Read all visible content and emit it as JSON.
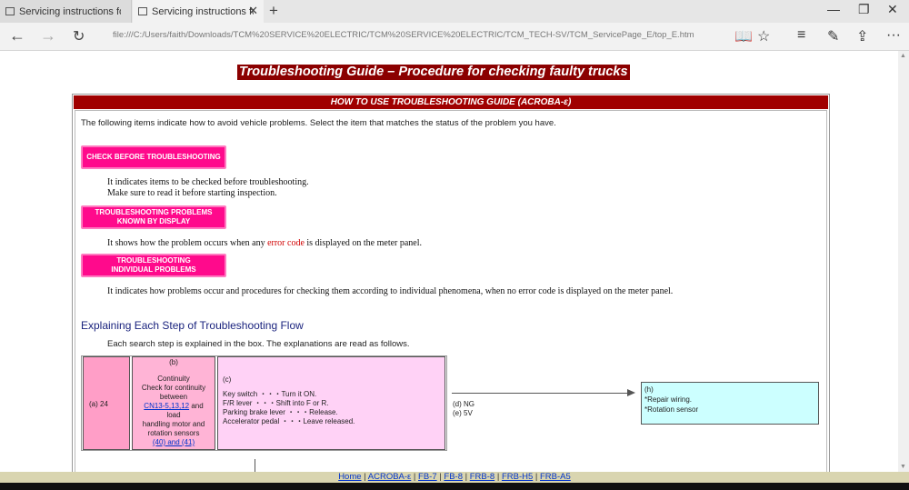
{
  "browser": {
    "tabs": [
      {
        "label": "Servicing instructions for elec"
      },
      {
        "label": "Servicing instructions for"
      }
    ],
    "address": "file:///C:/Users/faith/Downloads/TCM%20SERVICE%20ELECTRIC/TCM%20SERVICE%20ELECTRIC/TCM_TECH-SV/TCM_ServicePage_E/top_E.htm"
  },
  "page": {
    "title": "Troubleshooting Guide – Procedure for checking faulty trucks",
    "guide_header": "HOW TO USE TROUBLESHOOTING GUIDE (ACROBA-ε)",
    "intro": "The following items indicate how to avoid vehicle problems. Select the item that matches the status of the problem you have.",
    "buttons": {
      "check_before": "CHECK BEFORE TROUBLESHOOTING",
      "by_display_line1": "TROUBLESHOOTING PROBLEMS",
      "by_display_line2": "KNOWN BY DISPLAY",
      "individual_line1": "TROUBLESHOOTING",
      "individual_line2": "INDIVIDUAL PROBLEMS"
    },
    "desc_check_1": "It indicates items to be checked before troubleshooting.",
    "desc_check_2": "Make sure to read it before starting inspection.",
    "desc_display_pre": "It shows how the problem occurs when any ",
    "desc_display_err": "error code",
    "desc_display_post": " is displayed on the meter panel.",
    "desc_individual": "It indicates how problems occur and procedures for checking them according to individual phenomena, when no error code is displayed on the meter panel.",
    "flow_title": "Explaining Each Step of Troubleshooting Flow",
    "flow_intro": "Each search step is explained in the box. The explanations are read as follows.",
    "flow": {
      "cell_a": "(a)  24",
      "cell_b_tag": "(b)",
      "cell_b_1": "Continuity",
      "cell_b_2": "Check for continuity",
      "cell_b_3": "between",
      "cell_b_link": "CN13-5,13,12",
      "cell_b_and": " and",
      "cell_b_4": "load",
      "cell_b_5": "handling motor and",
      "cell_b_6": "rotation sensors",
      "cell_b_link2": "(40) and (41)",
      "cell_c_tag": "(c)",
      "cell_c_1": "Key switch ・・・Turn it ON.",
      "cell_c_2": "F/R lever ・・・Shift into F or R.",
      "cell_c_3": "Parking brake lever ・・・Release.",
      "cell_c_4": "Accelerator pedal ・・・Leave released.",
      "ng": "(d) NG",
      "sv": "(e) 5V",
      "h_tag": "(h)",
      "h_1": "*Repair wiring.",
      "h_2": "*Rotation sensor"
    },
    "footer_links": [
      "Home",
      "ACROBA-ε",
      "FB-7",
      "FB-8",
      "FRB-8",
      "FRB-H5",
      "FRB-A5"
    ]
  }
}
